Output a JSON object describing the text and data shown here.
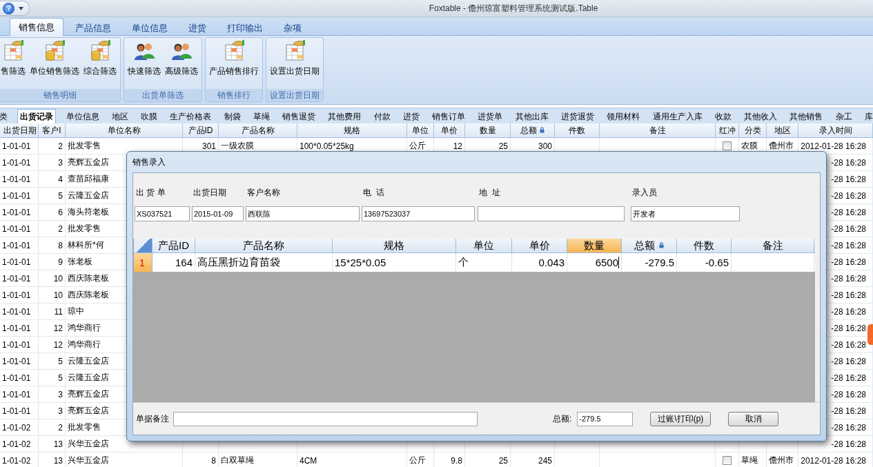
{
  "window": {
    "title": "Foxtable - 儋州琼富塑料管理系统测试版.Table",
    "help_glyph": "?"
  },
  "ribbon": {
    "tabs": [
      {
        "label": "销售信息",
        "selected": true
      },
      {
        "label": "产品信息",
        "selected": false
      },
      {
        "label": "单位信息",
        "selected": false
      },
      {
        "label": "进货",
        "selected": false
      },
      {
        "label": "打印输出",
        "selected": false
      },
      {
        "label": "杂项",
        "selected": false
      }
    ],
    "groups": [
      {
        "label": "销售明细",
        "items": [
          {
            "label": "售筛选",
            "kind": "sheet"
          },
          {
            "label": "单位销售筛选",
            "kind": "sheet-coin"
          },
          {
            "label": "综合筛选",
            "kind": "sheet-coin"
          }
        ]
      },
      {
        "label": "出货单筛选",
        "items": [
          {
            "label": "快速筛选",
            "kind": "people"
          },
          {
            "label": "高级筛选",
            "kind": "people"
          }
        ]
      },
      {
        "label": "销售排行",
        "items": [
          {
            "label": "产品销售排行",
            "kind": "sheet"
          }
        ]
      },
      {
        "label": "设置出货日期",
        "items": [
          {
            "label": "设置出货日期",
            "kind": "sheet"
          }
        ]
      }
    ]
  },
  "sheet_tabs": [
    {
      "label": "类",
      "selected": false
    },
    {
      "label": "出货记录",
      "selected": true
    },
    {
      "label": "单位信息",
      "selected": false
    },
    {
      "label": "地区",
      "selected": false
    },
    {
      "label": "吹膜",
      "selected": false
    },
    {
      "label": "生产价格表",
      "selected": false
    },
    {
      "label": "制袋",
      "selected": false
    },
    {
      "label": "草绳",
      "selected": false
    },
    {
      "label": "销售退货",
      "selected": false
    },
    {
      "label": "其他费用",
      "selected": false
    },
    {
      "label": "付款",
      "selected": false
    },
    {
      "label": "进货",
      "selected": false
    },
    {
      "label": "销售订单",
      "selected": false
    },
    {
      "label": "进货单",
      "selected": false
    },
    {
      "label": "其他出库",
      "selected": false
    },
    {
      "label": "进货退货",
      "selected": false
    },
    {
      "label": "领用材料",
      "selected": false
    },
    {
      "label": "通用生产入库",
      "selected": false
    },
    {
      "label": "收款",
      "selected": false
    },
    {
      "label": "其他收入",
      "selected": false
    },
    {
      "label": "其他销售",
      "selected": false
    },
    {
      "label": "杂工",
      "selected": false
    },
    {
      "label": "库",
      "selected": false
    }
  ],
  "table": {
    "columns": [
      {
        "label": "出货日期",
        "locked": false
      },
      {
        "label": "客户I",
        "locked": false
      },
      {
        "label": "单位名称",
        "locked": false
      },
      {
        "label": "产品ID",
        "locked": false
      },
      {
        "label": "产品名称",
        "locked": false
      },
      {
        "label": "规格",
        "locked": false
      },
      {
        "label": "单位",
        "locked": false
      },
      {
        "label": "单价",
        "locked": false
      },
      {
        "label": "数量",
        "locked": false
      },
      {
        "label": "总额",
        "locked": true
      },
      {
        "label": "件数",
        "locked": false
      },
      {
        "label": "备注",
        "locked": false
      },
      {
        "label": "红冲",
        "locked": false
      },
      {
        "label": "分类",
        "locked": false
      },
      {
        "label": "地区",
        "locked": false
      },
      {
        "label": "录入时间",
        "locked": false
      }
    ],
    "rows": [
      {
        "date": "1-01-01",
        "customer_id": "2",
        "unit_name": "批发零售",
        "product_id": "301",
        "product_name": "一级农膜",
        "spec": "100*0.05*25kg",
        "unit": "公斤",
        "price": "12",
        "qty": "25",
        "total": "300",
        "red_flag": false,
        "category": "农膜",
        "region": "儋州市",
        "time": "2012-01-28 16:28"
      },
      {
        "date": "1-01-01",
        "customer_id": "3",
        "unit_name": "亮辉五金店",
        "time": "-28 16:28"
      },
      {
        "date": "1-01-01",
        "customer_id": "4",
        "unit_name": "查苗邱福康",
        "time": "-28 16:28"
      },
      {
        "date": "1-01-01",
        "customer_id": "5",
        "unit_name": "云隆五金店",
        "time": "-28 16:28"
      },
      {
        "date": "1-01-01",
        "customer_id": "6",
        "unit_name": "海头符老板",
        "time": "-28 16:28"
      },
      {
        "date": "1-01-01",
        "customer_id": "2",
        "unit_name": "批发零售",
        "time": "-28 16:28"
      },
      {
        "date": "1-01-01",
        "customer_id": "8",
        "unit_name": "林科所*何",
        "time": "-28 16:28"
      },
      {
        "date": "1-01-01",
        "customer_id": "9",
        "unit_name": "张老板",
        "time": "-28 16:28"
      },
      {
        "date": "1-01-01",
        "customer_id": "10",
        "unit_name": "西庆陈老板",
        "time": "-28 16:28"
      },
      {
        "date": "1-01-01",
        "customer_id": "10",
        "unit_name": "西庆陈老板",
        "time": "-28 16:28"
      },
      {
        "date": "1-01-01",
        "customer_id": "11",
        "unit_name": "琼中",
        "time": "-28 16:28"
      },
      {
        "date": "1-01-01",
        "customer_id": "12",
        "unit_name": "鸿华商行",
        "time": "-28 16:28"
      },
      {
        "date": "1-01-01",
        "customer_id": "12",
        "unit_name": "鸿华商行",
        "time": "-28 16:28"
      },
      {
        "date": "1-01-01",
        "customer_id": "5",
        "unit_name": "云隆五金店",
        "time": "-28 16:28"
      },
      {
        "date": "1-01-01",
        "customer_id": "5",
        "unit_name": "云隆五金店",
        "time": "-28 16:28"
      },
      {
        "date": "1-01-01",
        "customer_id": "3",
        "unit_name": "亮辉五金店",
        "time": "-28 16:28"
      },
      {
        "date": "1-01-01",
        "customer_id": "3",
        "unit_name": "亮辉五金店",
        "time": "-28 16:28"
      },
      {
        "date": "1-01-02",
        "customer_id": "2",
        "unit_name": "批发零售",
        "time": "-28 16:28"
      },
      {
        "date": "1-01-02",
        "customer_id": "13",
        "unit_name": "兴华五金店",
        "time": "-28 16:28"
      },
      {
        "date": "1-01-02",
        "customer_id": "13",
        "unit_name": "兴华五金店",
        "product_id": "8",
        "product_name": "白双草绳",
        "spec": "4CM",
        "unit": "公斤",
        "price": "9.8",
        "qty": "25",
        "total": "245",
        "red_flag": false,
        "category": "草绳",
        "region": "儋州市",
        "time": "2012-01-28 16:28"
      }
    ]
  },
  "dialog": {
    "title": "销售录入",
    "fields": [
      {
        "label": "出 货 单",
        "value": "XS037521"
      },
      {
        "label": "出货日期",
        "value": "2015-01-09"
      },
      {
        "label": "客户名称",
        "value": "西联陈"
      },
      {
        "label": "电  话",
        "value": "13697523037"
      },
      {
        "label": "地  址"
      },
      {
        "label": "录入员",
        "value": "开发者"
      }
    ],
    "grid": {
      "columns": [
        {
          "label": "产品ID",
          "selected": false,
          "locked": false
        },
        {
          "label": "产品名称",
          "selected": false,
          "locked": false
        },
        {
          "label": "规格",
          "selected": false,
          "locked": false
        },
        {
          "label": "单位",
          "selected": false,
          "locked": false
        },
        {
          "label": "单价",
          "selected": false,
          "locked": false
        },
        {
          "label": "数量",
          "selected": true,
          "locked": false
        },
        {
          "label": "总额",
          "selected": false,
          "locked": true
        },
        {
          "label": "件数",
          "selected": false,
          "locked": false
        },
        {
          "label": "备注",
          "selected": false,
          "locked": false
        }
      ],
      "rows": [
        {
          "number": "1",
          "selected": true,
          "cells": [
            {
              "text": "164",
              "editing": false
            },
            {
              "text": "高压黑折边育苗袋",
              "editing": false
            },
            {
              "text": "15*25*0.05",
              "editing": false
            },
            {
              "text": "个",
              "editing": false
            },
            {
              "text": "0.043",
              "editing": false
            },
            {
              "text": "6500",
              "editing": true
            },
            {
              "text": "-279.5",
              "editing": false
            },
            {
              "text": "-0.65",
              "editing": false
            }
          ]
        }
      ]
    },
    "note": {
      "label": "单据备注"
    },
    "total": {
      "label": "总额:",
      "value": "-279.5"
    },
    "buttons": [
      {
        "label": "过账\\打印(p)"
      },
      {
        "label": "取消"
      }
    ]
  }
}
